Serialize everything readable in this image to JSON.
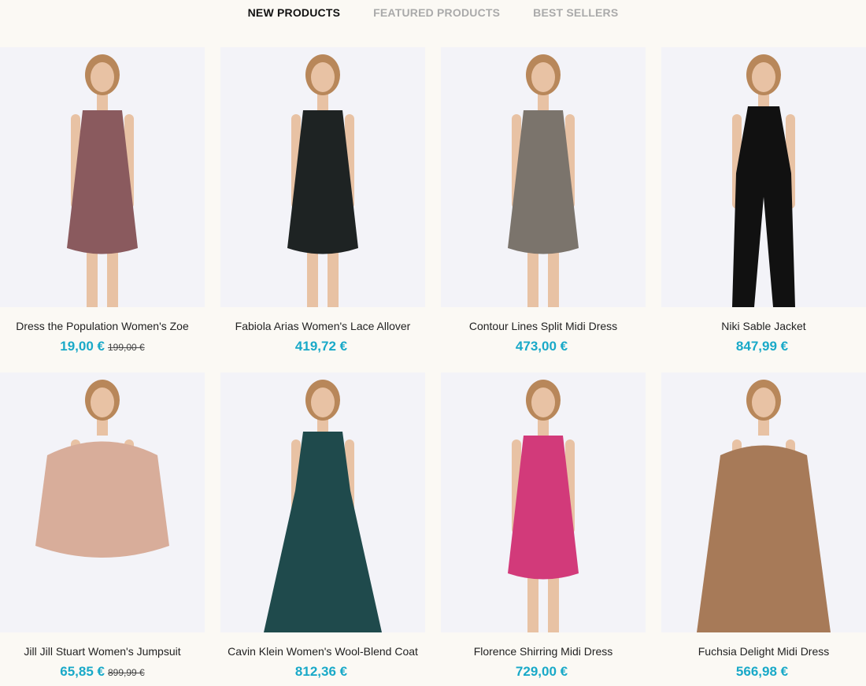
{
  "tabs": [
    {
      "label": "NEW PRODUCTS",
      "active": true
    },
    {
      "label": "FEATURED PRODUCTS",
      "active": false
    },
    {
      "label": "BEST SELLERS",
      "active": false
    }
  ],
  "products": [
    {
      "name": "Dress the Population Women's Zoe",
      "price": "19,00 €",
      "old_price": "199,00 €",
      "color": "#8a5a5e",
      "style": "dress"
    },
    {
      "name": "Fabiola Arias Women's Lace Allover",
      "price": "419,72 €",
      "old_price": "",
      "color": "#1e2323",
      "style": "dress"
    },
    {
      "name": "Contour Lines Split Midi Dress",
      "price": "473,00 €",
      "old_price": "",
      "color": "#7b746c",
      "style": "dress"
    },
    {
      "name": "Niki Sable Jacket",
      "price": "847,99 €",
      "old_price": "",
      "color": "#111111",
      "style": "jumpsuit"
    },
    {
      "name": "Jill Jill Stuart Women's Jumpsuit",
      "price": "65,85 €",
      "old_price": "899,99 €",
      "color": "#d8ad9a",
      "style": "fur"
    },
    {
      "name": "Cavin Klein Women's Wool-Blend Coat",
      "price": "812,36 €",
      "old_price": "",
      "color": "#1f4a4c",
      "style": "gown"
    },
    {
      "name": "Florence Shirring Midi Dress",
      "price": "729,00 €",
      "old_price": "",
      "color": "#d23a7a",
      "style": "dress"
    },
    {
      "name": "Fuchsia Delight Midi Dress",
      "price": "566,98 €",
      "old_price": "",
      "color": "#a77a58",
      "style": "coat"
    }
  ]
}
